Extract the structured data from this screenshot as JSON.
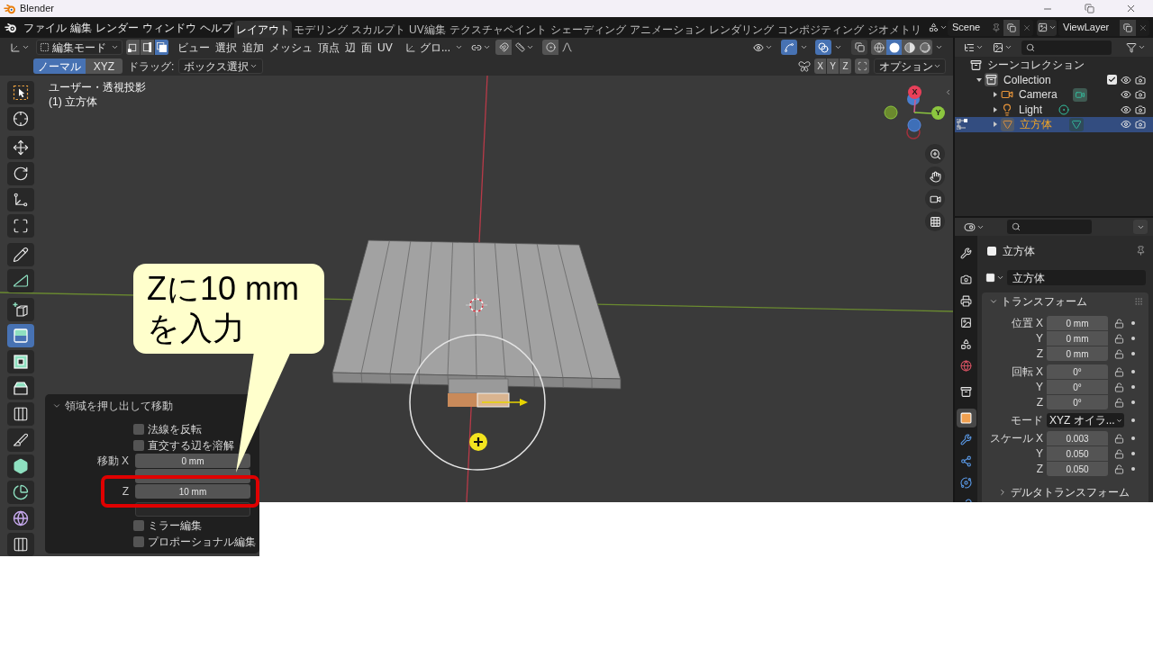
{
  "window": {
    "title": "Blender"
  },
  "top_bar": {
    "menus": [
      "ファイル",
      "編集",
      "レンダー",
      "ウィンドウ",
      "ヘルプ"
    ],
    "workspaces": [
      {
        "label": "レイアウト",
        "selected": true
      },
      {
        "label": "モデリング",
        "selected": false
      },
      {
        "label": "スカルプト",
        "selected": false
      },
      {
        "label": "UV編集",
        "selected": false
      },
      {
        "label": "テクスチャペイント",
        "selected": false
      },
      {
        "label": "シェーディング",
        "selected": false
      },
      {
        "label": "アニメーション",
        "selected": false
      },
      {
        "label": "レンダリング",
        "selected": false
      },
      {
        "label": "コンポジティング",
        "selected": false
      },
      {
        "label": "ジオメトリ",
        "selected": false
      }
    ],
    "scene": "Scene",
    "view_layer": "ViewLayer"
  },
  "viewport_header": {
    "mode": "編集モード",
    "select_modes": [
      {
        "selected": false
      },
      {
        "selected": false
      },
      {
        "selected": true
      }
    ],
    "menus": [
      "ビュー",
      "選択",
      "追加",
      "メッシュ",
      "頂点",
      "辺",
      "面",
      "UV"
    ],
    "orientation": "グロ...",
    "gizmos": {
      "on": true
    },
    "overlays": {
      "on": true
    },
    "xray": {
      "on": false
    },
    "shading_modes": [
      {
        "selected": false
      },
      {
        "selected": true
      },
      {
        "selected": false
      },
      {
        "selected": false
      }
    ]
  },
  "tool_header": {
    "orientation_buttons": [
      {
        "label": "ノーマル",
        "selected": true
      },
      {
        "label": "XYZ",
        "selected": false
      }
    ],
    "drag_label": "ドラッグ:",
    "drag_mode": "ボックス選択",
    "mirror_axes": [
      {
        "label": "X",
        "on": false
      },
      {
        "label": "Y",
        "on": false
      },
      {
        "label": "Z",
        "on": false
      }
    ],
    "options": "オプション"
  },
  "viewport": {
    "view_name": "ユーザー・透視投影",
    "object_info": "(1) 立方体",
    "gizmo_axes": [
      "X",
      "Y"
    ],
    "tools": [
      {
        "selected": false
      },
      {
        "selected": false
      },
      {
        "selected": false
      },
      {
        "selected": false
      },
      {
        "selected": false
      },
      {
        "selected": false
      },
      {
        "selected": false
      },
      {
        "selected": false
      },
      {
        "selected": false
      },
      {
        "selected": true
      },
      {
        "selected": false
      },
      {
        "selected": false
      },
      {
        "selected": false
      },
      {
        "selected": false
      },
      {
        "selected": false
      },
      {
        "selected": false
      },
      {
        "selected": false
      },
      {
        "selected": false
      }
    ]
  },
  "operator_panel": {
    "title": "領域を押し出して移動",
    "expanded": true,
    "rows": [
      {
        "kind": "checkbox",
        "label": "法線を反転",
        "checked": false
      },
      {
        "kind": "checkbox",
        "label": "直交する辺を溶解",
        "checked": false
      },
      {
        "kind": "number",
        "label": "移動 X",
        "value": "0 mm"
      },
      {
        "kind": "number"
      },
      {
        "kind": "number",
        "label": "Z",
        "value": "10 mm"
      },
      {
        "kind": "dropdown"
      },
      {
        "kind": "checkbox",
        "label": "ミラー編集",
        "checked": false
      },
      {
        "kind": "checkbox",
        "label": "プロポーショナル編集",
        "checked": false
      }
    ]
  },
  "callout": {
    "text": "Zに10 mm\nを入力"
  },
  "outliner": {
    "tree": [
      {
        "label": "シーンコレクション",
        "kind": "scene_collection",
        "selected": false,
        "children": [
          {
            "label": "Collection",
            "kind": "collection",
            "expanded": true,
            "checked": true,
            "selected": false,
            "children": [
              {
                "label": "Camera",
                "kind": "camera",
                "expanded": false,
                "selected": false,
                "editing": false
              },
              {
                "label": "Light",
                "kind": "light",
                "expanded": false,
                "selected": false,
                "editing": false
              },
              {
                "label": "立方体",
                "kind": "mesh",
                "expanded": false,
                "selected": true,
                "editing": true
              }
            ]
          }
        ]
      }
    ]
  },
  "properties": {
    "tabs": [
      {
        "selected": false
      },
      {
        "selected": false
      },
      {
        "selected": false
      },
      {
        "selected": false
      },
      {
        "selected": false
      },
      {
        "selected": false
      },
      {
        "selected": false
      },
      {
        "selected": true
      },
      {
        "selected": false
      },
      {
        "selected": false
      },
      {
        "selected": false
      },
      {
        "selected": false
      }
    ],
    "object_name": "立方体",
    "name_field": "立方体",
    "panel": {
      "title": "トランスフォーム",
      "expanded": true,
      "groups": [
        [
          {
            "kind": "number",
            "label": "位置 X",
            "value": "0 mm"
          },
          {
            "kind": "number",
            "label": "Y",
            "value": "0 mm"
          },
          {
            "kind": "number",
            "label": "Z",
            "value": "0 mm"
          }
        ],
        [
          {
            "kind": "number",
            "label": "回転 X",
            "value": "0°"
          },
          {
            "kind": "number",
            "label": "Y",
            "value": "0°"
          },
          {
            "kind": "number",
            "label": "Z",
            "value": "0°"
          }
        ],
        [
          {
            "kind": "dropdown",
            "label": "モード",
            "value": "XYZ オイラ..."
          }
        ],
        [
          {
            "kind": "number",
            "label": "スケール X",
            "value": "0.003"
          },
          {
            "kind": "number",
            "label": "Y",
            "value": "0.050"
          },
          {
            "kind": "number",
            "label": "Z",
            "value": "0.050"
          }
        ]
      ],
      "subpanels": [
        {
          "title": "デルタトランスフォーム",
          "expanded": false
        }
      ]
    }
  }
}
